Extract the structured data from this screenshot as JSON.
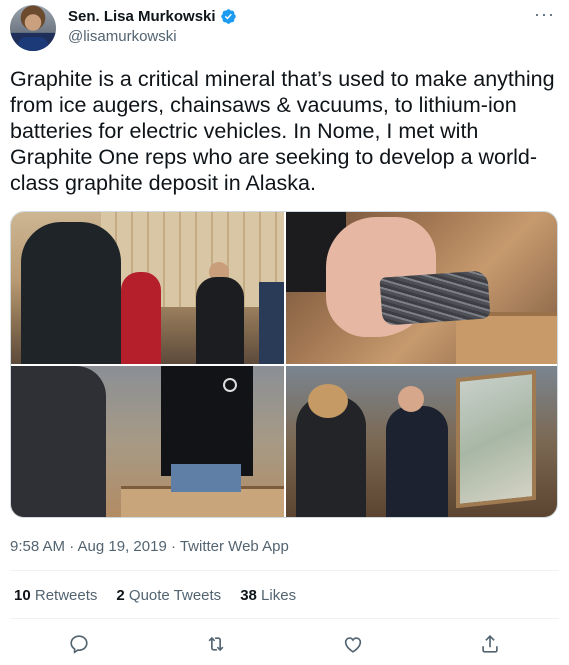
{
  "author": {
    "display_name": "Sen. Lisa Murkowski",
    "handle": "@lisamurkowski",
    "verified": true
  },
  "menu": {
    "more_icon": "ellipsis-icon",
    "more_label": "···"
  },
  "tweet": {
    "text": "Graphite is a critical mineral that’s used to make anything from ice augers, chainsaws & vacuums, to lithium-ion batteries for electric vehicles. In Nome, I met with Graphite One reps who are seeking to develop a world-class graphite deposit in Alaska.",
    "timestamp": "9:58 AM · Aug 19, 2019 · Twitter Web App"
  },
  "media": {
    "count": 4
  },
  "stats": {
    "retweets_count": "10",
    "retweets_label": "Retweets",
    "quotes_count": "2",
    "quotes_label": "Quote Tweets",
    "likes_count": "38",
    "likes_label": "Likes"
  },
  "actions": {
    "reply_icon": "reply-icon",
    "retweet_icon": "retweet-icon",
    "like_icon": "heart-icon",
    "share_icon": "share-icon"
  },
  "colors": {
    "text_primary": "#0f1419",
    "text_secondary": "#536471",
    "verified_blue": "#1d9bf0",
    "divider": "#eff3f4"
  }
}
